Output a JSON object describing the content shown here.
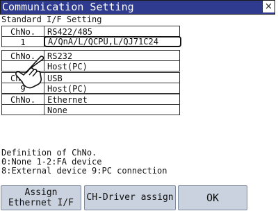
{
  "window": {
    "title": "Communication Setting",
    "close_symbol": "×"
  },
  "section_label": "Standard I/F Setting",
  "interfaces": [
    {
      "ch_header": "ChNo.",
      "name": "RS422/485",
      "ch": "1",
      "value": "A/QnA/L/QCPU,L/QJ71C24",
      "selected": true
    },
    {
      "ch_header": "ChNo.",
      "name": "RS232",
      "ch": "",
      "value": "Host(PC)",
      "selected": false
    },
    {
      "ch_header": "ChNo.",
      "name": "USB",
      "ch": "9",
      "value": "Host(PC)",
      "selected": false
    },
    {
      "ch_header": "ChNo.",
      "name": "Ethernet",
      "ch": "",
      "value": "None",
      "selected": false
    }
  ],
  "definition": {
    "heading": "Definition of ChNo.",
    "line1": "0:None 1-2:FA device",
    "line2": "8:External device 9:PC connection"
  },
  "buttons": {
    "assign_line1": "Assign",
    "assign_line2": "Ethernet I/F",
    "driver": "CH-Driver assign",
    "ok": "OK"
  },
  "colors": {
    "titlebar": "#2e3b8f",
    "button": "#c9d2de"
  },
  "icons": {
    "pointer": "hand-pointer-icon"
  }
}
